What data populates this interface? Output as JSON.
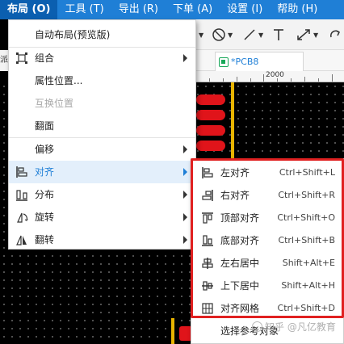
{
  "menubar": {
    "items": [
      {
        "label": "布局 (O)",
        "active": true
      },
      {
        "label": "工具 (T)"
      },
      {
        "label": "导出 (R)"
      },
      {
        "label": "下单 (A)"
      },
      {
        "label": "设置 (I)"
      },
      {
        "label": "帮助 (H)"
      }
    ]
  },
  "left_strip": {
    "text": "派"
  },
  "tab": {
    "label": "*PCB8"
  },
  "ruler": {
    "label": "2000"
  },
  "layout_menu": {
    "items": [
      {
        "label": "自动布局(预览版)"
      },
      {
        "label": "组合"
      },
      {
        "label": "属性位置..."
      },
      {
        "label": "互换位置"
      },
      {
        "label": "翻面"
      },
      {
        "label": "偏移"
      },
      {
        "label": "对齐"
      },
      {
        "label": "分布"
      },
      {
        "label": "旋转"
      },
      {
        "label": "翻转"
      }
    ]
  },
  "align_submenu": {
    "items": [
      {
        "label": "左对齐",
        "shortcut": "Ctrl+Shift+L"
      },
      {
        "label": "右对齐",
        "shortcut": "Ctrl+Shift+R"
      },
      {
        "label": "顶部对齐",
        "shortcut": "Ctrl+Shift+O"
      },
      {
        "label": "底部对齐",
        "shortcut": "Ctrl+Shift+B"
      },
      {
        "label": "左右居中",
        "shortcut": "Shift+Alt+E"
      },
      {
        "label": "上下居中",
        "shortcut": "Shift+Alt+H"
      },
      {
        "label": "对齐网格",
        "shortcut": "Ctrl+Shift+D"
      },
      {
        "label": "选择参考对象",
        "shortcut": ""
      }
    ]
  },
  "watermark": {
    "text": "知乎 @凡亿教育"
  },
  "colors": {
    "menubar": "#1f7fd6",
    "highlight": "#e3effb",
    "red_frame": "#e02020",
    "pad": "#e0141a",
    "trace": "#e8b400"
  }
}
